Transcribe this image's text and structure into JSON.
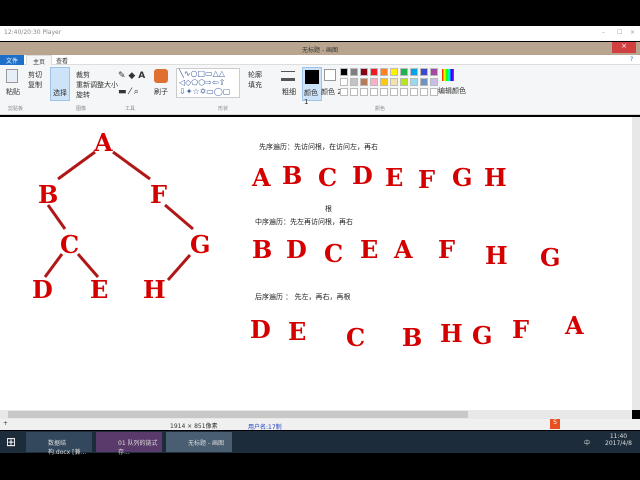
{
  "player": {
    "title": "12:40/20:30 Player"
  },
  "window": {
    "title": "无标题 - 画图"
  },
  "tabs": [
    "文件",
    "主页",
    "查看"
  ],
  "ribbon": {
    "paste": "粘贴",
    "cut": "剪切",
    "copy": "复制",
    "select": "选择",
    "crop": "裁剪",
    "resize": "重新调整大小",
    "rotate": "旋转",
    "brushes": "刷子",
    "outline": "轮廓",
    "fill": "填充",
    "size": "粗细",
    "color1": "颜色 1",
    "color2": "颜色 2",
    "edit_colors": "编辑颜色",
    "groups": [
      "剪贴板",
      "图像",
      "工具",
      "形状",
      "颜色"
    ]
  },
  "palette": [
    "#000000",
    "#7f7f7f",
    "#880015",
    "#ed1c24",
    "#ff7f27",
    "#fff200",
    "#22b14c",
    "#00a2e8",
    "#3f48cc",
    "#a349a4",
    "#ffffff",
    "#c3c3c3",
    "#b97a57",
    "#ffaec9",
    "#ffc90e",
    "#efe4b0",
    "#b5e61d",
    "#99d9ea",
    "#7092be",
    "#c8bfe7"
  ],
  "tree": {
    "nodes": [
      "A",
      "B",
      "F",
      "C",
      "G",
      "D",
      "E",
      "H"
    ]
  },
  "preorder": {
    "caption": "先序遍历：先访问根，在访问左，再右",
    "letters": [
      "A",
      "B",
      "C",
      "D",
      "E",
      "F",
      "G",
      "H"
    ]
  },
  "root_note": "根",
  "inorder": {
    "caption": "中序遍历：先左再访问根，再右",
    "letters": [
      "B",
      "D",
      "C",
      "E",
      "A",
      "F",
      "H",
      "G"
    ]
  },
  "postorder": {
    "caption": "后序遍历 ： 先左，再右，再根",
    "letters": [
      "D",
      "E",
      "C",
      "B",
      "H",
      "G",
      "F",
      "A"
    ]
  },
  "status": {
    "size": "1914 × 851像素",
    "user": "用户名:17制"
  },
  "taskbar": {
    "items": [
      "数据结构.docx [兼...",
      "01 队列的链式存...",
      "无标题 - 画图"
    ],
    "ime": "中",
    "time": "11:40",
    "date": "2017/4/8"
  }
}
